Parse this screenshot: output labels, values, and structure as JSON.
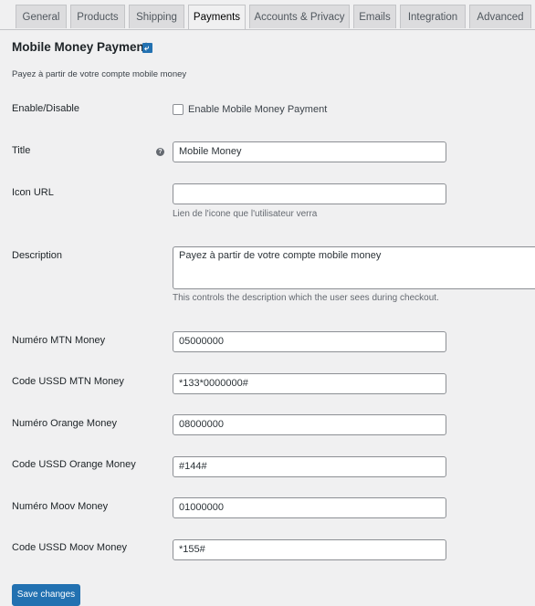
{
  "tabs": [
    {
      "label": "General"
    },
    {
      "label": "Products"
    },
    {
      "label": "Shipping"
    },
    {
      "label": "Payments"
    },
    {
      "label": "Accounts & Privacy"
    },
    {
      "label": "Emails"
    },
    {
      "label": "Integration"
    },
    {
      "label": "Advanced"
    }
  ],
  "active_tab": "Payments",
  "section": {
    "title": "Mobile Money Payment",
    "badge_icon": "return-arrow-icon",
    "subtitle": "Payez à partir de votre compte mobile money"
  },
  "fields": {
    "enable": {
      "label": "Enable/Disable",
      "checkbox_label": "Enable Mobile Money Payment",
      "checked": false
    },
    "title": {
      "label": "Title",
      "value": "Mobile Money",
      "tip_icon": "help-icon"
    },
    "icon_url": {
      "label": "Icon URL",
      "value": "",
      "help": "Lien de l'icone que l'utilisateur verra"
    },
    "description": {
      "label": "Description",
      "value": "Payez à partir de votre compte mobile money",
      "help": "This controls the description which the user sees during checkout."
    },
    "mtn_number": {
      "label": "Numéro MTN Money",
      "value": "05000000"
    },
    "mtn_ussd": {
      "label": "Code USSD MTN Money",
      "value": "*133*0000000#"
    },
    "orange_number": {
      "label": "Numéro Orange Money",
      "value": "08000000"
    },
    "orange_ussd": {
      "label": "Code USSD Orange Money",
      "value": "#144#"
    },
    "moov_number": {
      "label": "Numéro Moov Money",
      "value": "01000000"
    },
    "moov_ussd": {
      "label": "Code USSD Moov Money",
      "value": "*155#"
    }
  },
  "save_button": {
    "label": "Save changes"
  },
  "colors": {
    "accent": "#2271b1",
    "background": "#f0f0f1"
  }
}
